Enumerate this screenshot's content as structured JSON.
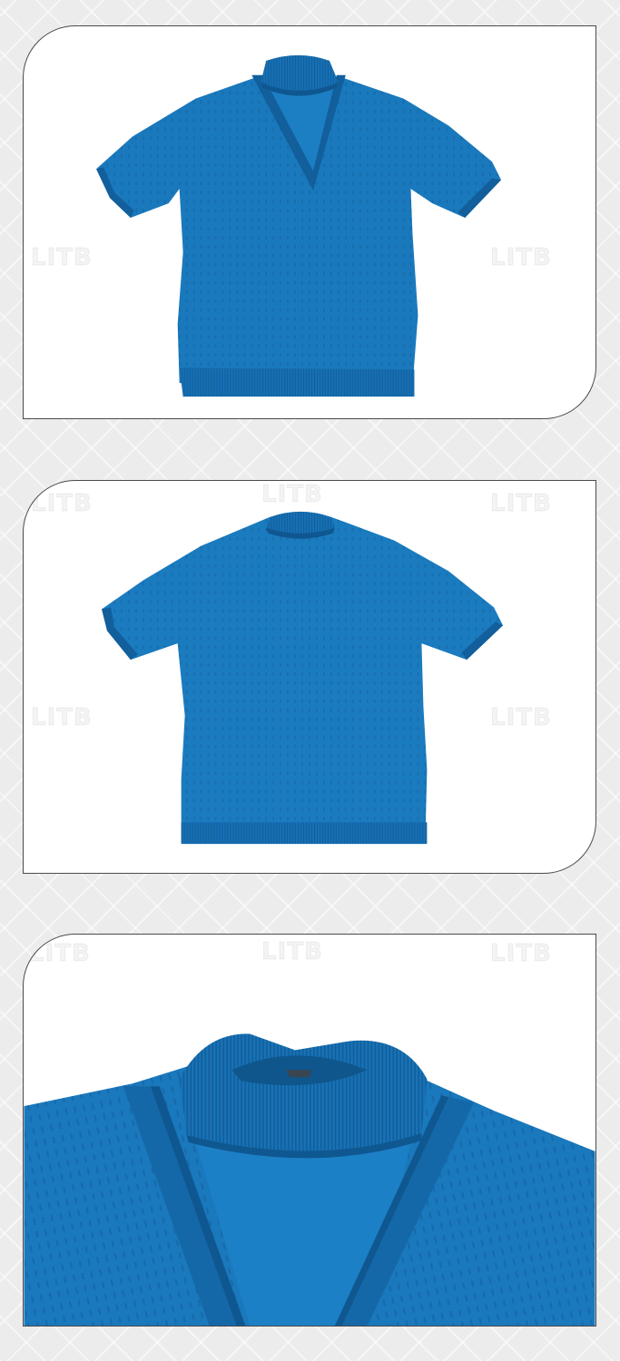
{
  "watermark": {
    "text": "LITB"
  },
  "colors": {
    "shirt": "#1a79bd",
    "shirt_dark": "#11609c",
    "shirt_light": "#2b8ecf",
    "panel_bg": "#ffffff",
    "page_bg": "#ececec"
  },
  "panels": [
    {
      "name": "front-view",
      "icon": "shirt-front-image"
    },
    {
      "name": "back-view",
      "icon": "shirt-back-image"
    },
    {
      "name": "collar-closeup",
      "icon": "collar-detail-image"
    }
  ]
}
